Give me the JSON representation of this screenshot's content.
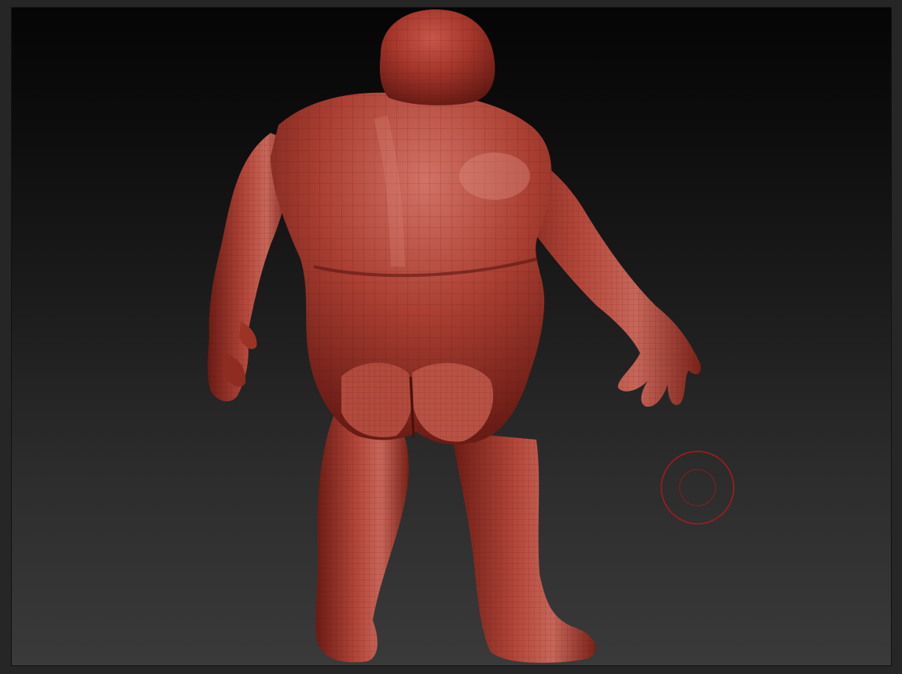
{
  "app": {
    "viewport_background_top": "#050505",
    "viewport_background_bottom": "#3a3a3a",
    "frame_color": "#262626"
  },
  "model": {
    "material_color": "#b0392a",
    "highlight_color": "#d9786a",
    "shadow_color": "#5a1510",
    "wireframe_color": "#3c0d08"
  },
  "brush_cursor": {
    "icon": "brush-cursor-icon",
    "color": "#b01818"
  }
}
